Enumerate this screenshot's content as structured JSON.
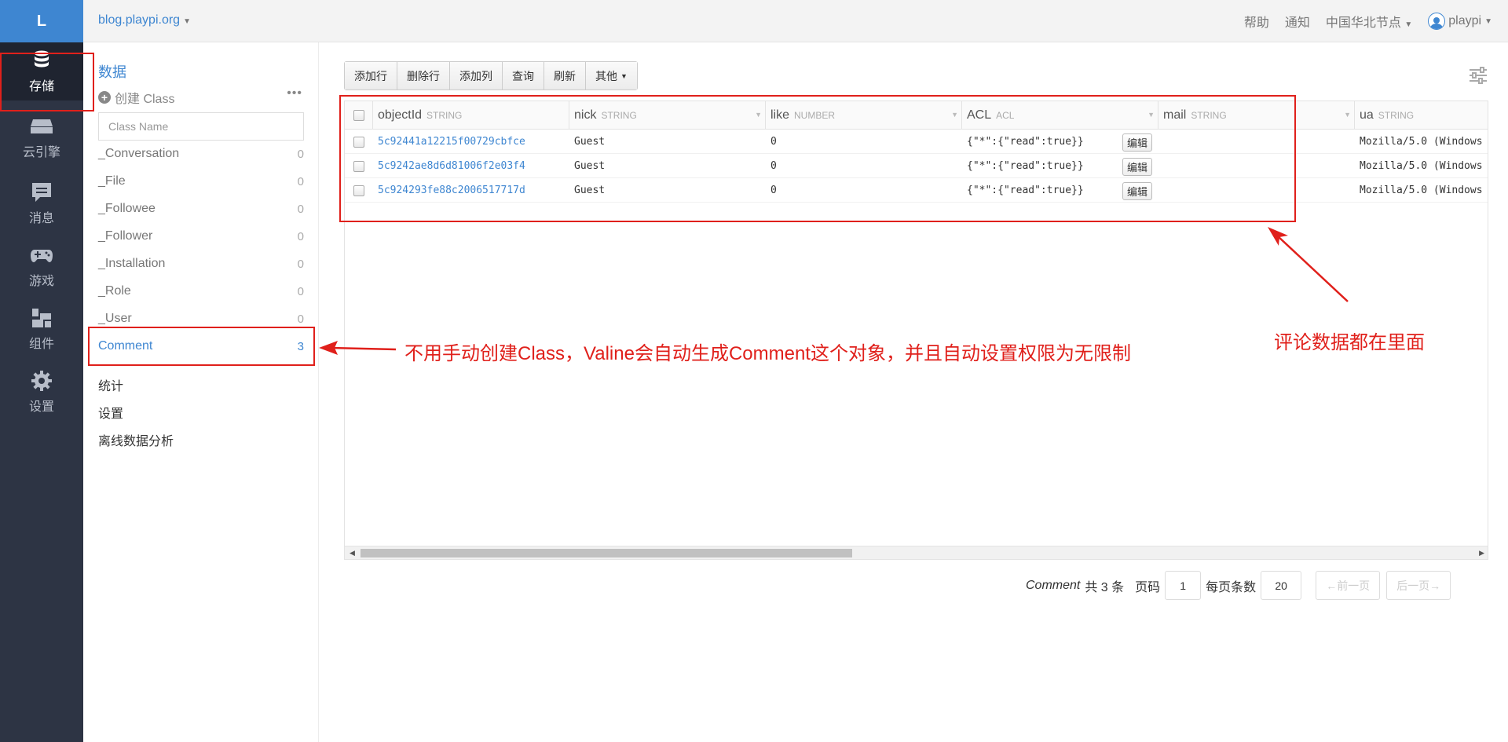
{
  "app": {
    "logo_letter": "L",
    "site": "blog.playpi.org"
  },
  "rail": [
    {
      "label": "存储",
      "icon": "database-icon",
      "active": true
    },
    {
      "label": "云引擎",
      "icon": "engine-icon"
    },
    {
      "label": "消息",
      "icon": "message-icon"
    },
    {
      "label": "游戏",
      "icon": "gamepad-icon"
    },
    {
      "label": "组件",
      "icon": "components-icon"
    },
    {
      "label": "设置",
      "icon": "gear-icon"
    }
  ],
  "topbar": {
    "help": "帮助",
    "notify": "通知",
    "region": "中国华北节点",
    "user": "playpi"
  },
  "sidebar": {
    "title": "数据",
    "create": "创建 Class",
    "search_placeholder": "Class Name",
    "classes": [
      {
        "name": "_Conversation",
        "count": "0"
      },
      {
        "name": "_File",
        "count": "0"
      },
      {
        "name": "_Followee",
        "count": "0"
      },
      {
        "name": "_Follower",
        "count": "0"
      },
      {
        "name": "_Installation",
        "count": "0"
      },
      {
        "name": "_Role",
        "count": "0"
      },
      {
        "name": "_User",
        "count": "0"
      },
      {
        "name": "Comment",
        "count": "3",
        "active": true
      }
    ],
    "links": [
      "统计",
      "设置",
      "离线数据分析"
    ]
  },
  "toolbar": {
    "add_row": "添加行",
    "del_row": "删除行",
    "add_col": "添加列",
    "query": "查询",
    "refresh": "刷新",
    "other": "其他"
  },
  "table": {
    "columns": [
      {
        "name": "objectId",
        "type": "STRING"
      },
      {
        "name": "nick",
        "type": "STRING"
      },
      {
        "name": "like",
        "type": "NUMBER"
      },
      {
        "name": "ACL",
        "type": "ACL"
      },
      {
        "name": "mail",
        "type": "STRING"
      },
      {
        "name": "ua",
        "type": "STRING"
      }
    ],
    "edit_label": "编辑",
    "rows": [
      {
        "objectId": "5c92441a12215f00729cbfce",
        "nick": "Guest",
        "like": "0",
        "acl": "{\"*\":{\"read\":true}}",
        "mail": "",
        "ua": "Mozilla/5.0 (Windows"
      },
      {
        "objectId": "5c9242ae8d6d81006f2e03f4",
        "nick": "Guest",
        "like": "0",
        "acl": "{\"*\":{\"read\":true}}",
        "mail": "",
        "ua": "Mozilla/5.0 (Windows"
      },
      {
        "objectId": "5c924293fe88c2006517717d",
        "nick": "Guest",
        "like": "0",
        "acl": "{\"*\":{\"read\":true}}",
        "mail": "",
        "ua": "Mozilla/5.0 (Windows"
      }
    ]
  },
  "pager": {
    "class_name": "Comment",
    "total": "共 3 条",
    "page_label": "页码",
    "page": "1",
    "per_page_label": "每页条数",
    "per_page": "20",
    "prev": "←前一页",
    "next": "后一页→"
  },
  "annotations": {
    "comment_note": "不用手动创建Class，Valine会自动生成Comment这个对象，并且自动设置权限为无限制",
    "data_note": "评论数据都在里面"
  }
}
